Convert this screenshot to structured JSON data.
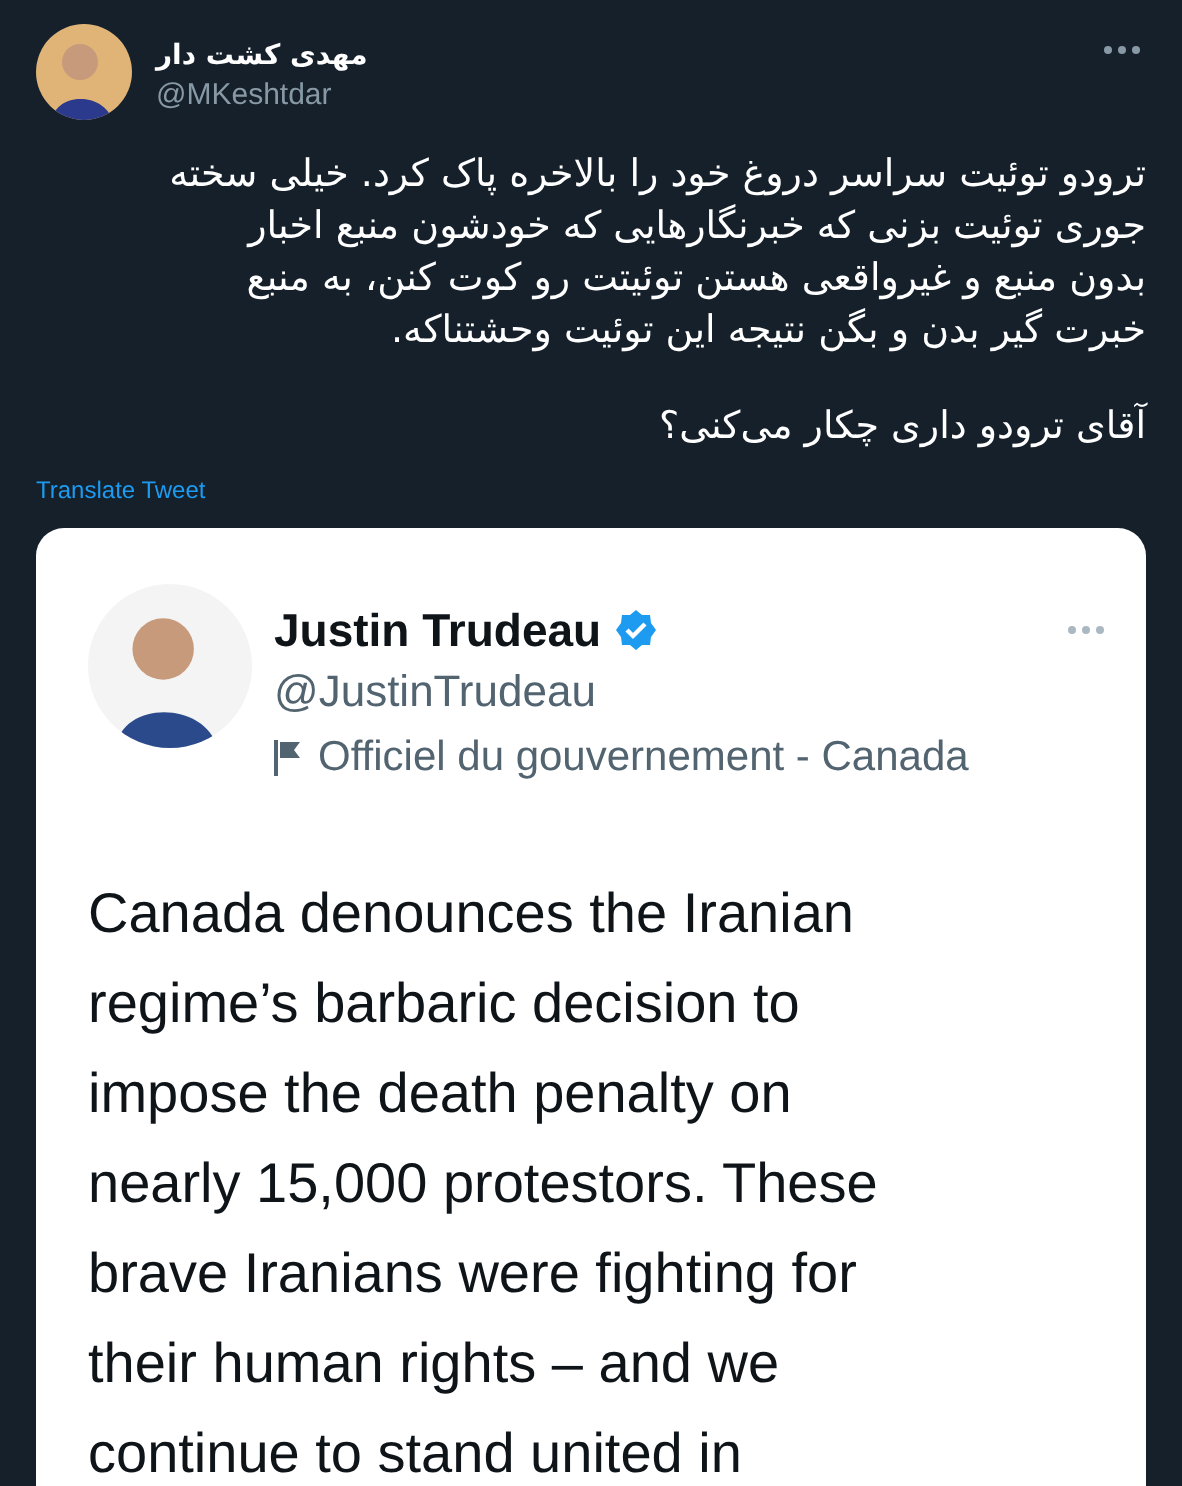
{
  "tweet": {
    "author": {
      "name": "مهدی کشت دار",
      "handle": "@MKeshtdar"
    },
    "text_lines": [
      "ترودو توئیت سراسر دروغ خود را بالاخره پاک کرد. خیلی سخته",
      "جوری توئیت بزنی که خبرنگارهایی که خودشون منبع اخبار",
      "بدون منبع و غیرواقعی هستن توئیتت رو کوت کنن، به منبع",
      "خبرت گیر بدن و بگن نتیجه این توئیت وحشتناکه."
    ],
    "second_paragraph": "آقای ترودو داری چکار می‌کنی؟",
    "translate_link": "Translate Tweet",
    "embedded_screenshot": {
      "author": {
        "name": "Justin Trudeau",
        "verified": true,
        "handle": "@JustinTrudeau",
        "label": "Officiel du gouvernement - Canada"
      },
      "text_lines": [
        "Canada denounces the Iranian",
        "regime’s barbaric decision to",
        "impose the death penalty on",
        "nearly 15,000 protestors. These",
        "brave Iranians were fighting for",
        "their human rights – and we",
        "continue to stand united in"
      ]
    }
  }
}
